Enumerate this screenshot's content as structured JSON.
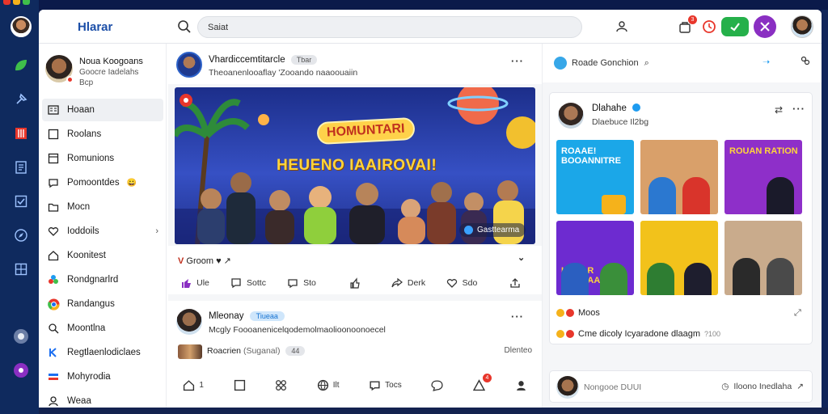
{
  "app": {
    "logo": "Hlarar"
  },
  "search": {
    "value": "Saiat"
  },
  "colors": {
    "brand": "#1c4fa8",
    "accent_green": "#25b04a",
    "accent_purple": "#8a2fc2",
    "badge_red": "#e8362b",
    "verified_blue": "#1d9bf0"
  },
  "topbar": {
    "notif_count": "3",
    "icons": [
      "search-icon",
      "people-icon",
      "bag-icon",
      "timer-icon",
      "check-icon",
      "tools-icon",
      "avatar"
    ]
  },
  "sidebar": {
    "profile": {
      "name": "Noua Koogoans",
      "sub1": "Goocre Iadelahs",
      "sub2": "Bcp"
    },
    "items": [
      {
        "label": "Hoaan",
        "icon": "feed-icon",
        "active": true
      },
      {
        "label": "Roolans",
        "icon": "square-icon"
      },
      {
        "label": "Romunions",
        "icon": "list-icon"
      },
      {
        "label": "Pomoontdes",
        "icon": "chat-icon",
        "emoji": "😀"
      },
      {
        "label": "Mocn",
        "icon": "folder-icon"
      },
      {
        "label": "Ioddoils",
        "icon": "heart-icon",
        "chevron": "›"
      },
      {
        "label": "Koonitest",
        "icon": "home-icon"
      },
      {
        "label": "Rondgnarlrd",
        "icon": "cluster-icon"
      },
      {
        "label": "Randangus",
        "icon": "chrome-icon"
      },
      {
        "label": "Moontlna",
        "icon": "search-icon"
      },
      {
        "label": "Regtlaenlodiclaes",
        "icon": "k-icon"
      },
      {
        "label": "Mohyrodia",
        "icon": "bars-icon"
      },
      {
        "label": "Weaa",
        "icon": "person-icon"
      }
    ]
  },
  "feed": {
    "post1": {
      "author": "Vhardiccemtitarcle",
      "tag": "Tbar",
      "subtitle": "Theoanenlooaflay 'Zooando naaoouaiin",
      "hero_title": "HOMUNTARI",
      "hero_subtitle": "HEUENO IAAIROVAI!",
      "hero_chip": "Gasttearma",
      "reaction_label": "Groom",
      "actions": [
        {
          "label": "Ule",
          "icon": "like-icon"
        },
        {
          "label": "Sottc",
          "icon": "comment-icon"
        },
        {
          "label": "Sto",
          "icon": "chat-icon"
        },
        {
          "label": "",
          "icon": "thumb-icon"
        },
        {
          "label": "Derk",
          "icon": "share-icon"
        },
        {
          "label": "Sdo",
          "icon": "heart-icon"
        },
        {
          "label": "",
          "icon": "upload-icon"
        }
      ]
    },
    "post2": {
      "author": "Mleonay",
      "tag": "Tiueaa",
      "subtitle": "Mcgly Foooanenicelqodemolmaolioonoonoecel",
      "line_text": "Roacrien",
      "line_gray": "(Suganal)",
      "line_count": "44",
      "right_text": "Dlenteo",
      "icons": [
        {
          "label": "1",
          "icon": "home-icon"
        },
        {
          "label": "",
          "icon": "square-icon"
        },
        {
          "label": "",
          "icon": "cluster-icon"
        },
        {
          "label": "Ilt",
          "icon": "globe-icon"
        },
        {
          "label": "Tocs",
          "icon": "chat-icon"
        },
        {
          "label": "",
          "icon": "comment-icon"
        },
        {
          "label": "",
          "icon": "warning-icon",
          "badge": "4"
        },
        {
          "label": "",
          "icon": "person-icon"
        }
      ]
    }
  },
  "right": {
    "header": "Roade Gonchion",
    "card": {
      "name": "Dlahahe",
      "subtitle": "Dlaebuce Il2bg",
      "tiles": [
        {
          "title": "ROAAE! BOOANNITRE",
          "bg": "#1ba7e8",
          "fg": "#ffffff"
        },
        {
          "title": "",
          "bg": "#d9a06a",
          "fg": "#ffffff"
        },
        {
          "title": "ROUAN RATION",
          "bg": "#8e2fc9",
          "fg": "#ffd43b"
        },
        {
          "title": "HOAAR NOEOAAS",
          "bg": "#6d2bd0",
          "fg": "#ffd43b"
        },
        {
          "title": "",
          "bg": "#f2c21b",
          "fg": "#111111"
        },
        {
          "title": "",
          "bg": "#c9ab8c",
          "fg": "#ffffff"
        }
      ],
      "footer1": "Moos",
      "footer2": "Cme dicoly Icyaradone dlaagm",
      "footer2_gray": "?100"
    },
    "compose": {
      "placeholder": "Nongooe DUUI",
      "right_text": "Iloono Inedlaha"
    }
  }
}
